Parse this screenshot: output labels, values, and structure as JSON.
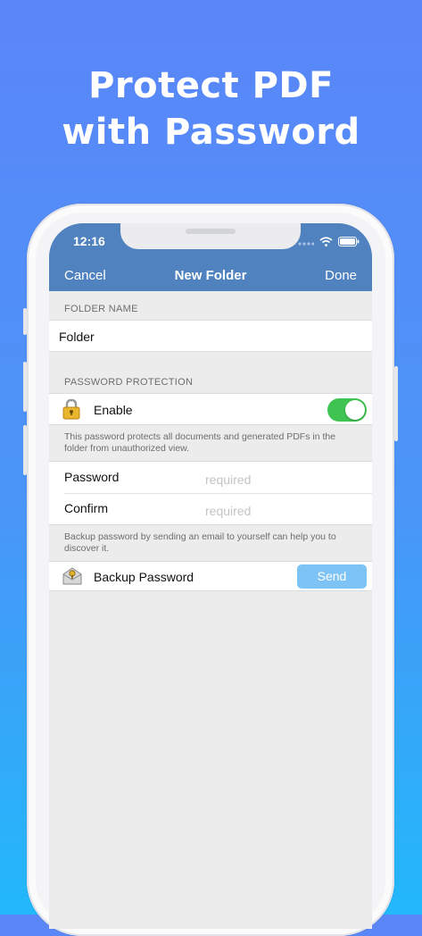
{
  "headline": {
    "line1": "Protect PDF",
    "line2": "with Password"
  },
  "status_bar": {
    "time": "12:16"
  },
  "navbar": {
    "cancel_label": "Cancel",
    "title": "New Folder",
    "done_label": "Done"
  },
  "folder_name": {
    "header": "FOLDER NAME",
    "value": "Folder"
  },
  "password_protection": {
    "header": "PASSWORD PROTECTION",
    "enable_label": "Enable",
    "enabled": true,
    "description": "This password protects all documents and generated PDFs in the folder from unauthorized view."
  },
  "password_fields": {
    "password_label": "Password",
    "password_placeholder": "required",
    "confirm_label": "Confirm",
    "confirm_placeholder": "required",
    "backup_hint": "Backup password by sending an email to yourself can help you to discover it."
  },
  "backup": {
    "label": "Backup Password",
    "send_label": "Send"
  },
  "colors": {
    "navbar": "#4f82bf",
    "toggle_on": "#3fc351",
    "send_button": "#7ec3f5",
    "background_top": "#5b86f8",
    "background_bottom": "#22b8fb"
  },
  "icons": {
    "lock": "lock-icon",
    "envelope": "envelope-icon",
    "wifi": "wifi-icon",
    "battery": "battery-icon",
    "signal": "signal-icon"
  }
}
